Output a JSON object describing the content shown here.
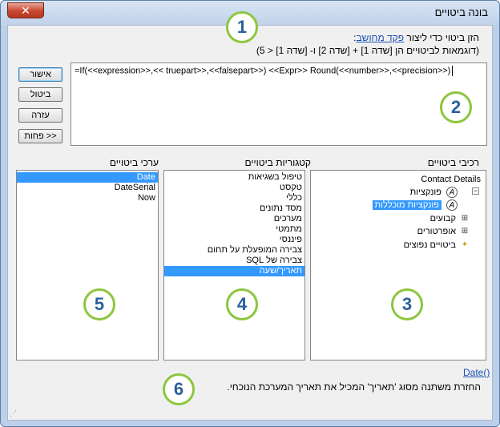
{
  "window": {
    "title": "בונה ביטויים",
    "close_label": "✕"
  },
  "intro": {
    "line1_prefix": "הזן ביטוי כדי ליצור",
    "line1_link": "פקד מחושב",
    "line1_suffix": ":",
    "line2": "(דוגמאות לביטויים הן [שדה 1] + [שדה 2] ו- [שדה 1] < 5)"
  },
  "expression": "=If(<<expression>>,<< truepart>>,<<falsepart>>) <<Expr>> Round(<<number>>,<<precision>>)",
  "buttons": {
    "ok": "אישור",
    "cancel": "ביטול",
    "help": "עזרה",
    "less": "<< פחות"
  },
  "headers": {
    "elements": "רכיבי ביטויים",
    "categories": "קטגוריות ביטויים",
    "values": "ערכי ביטויים"
  },
  "elements_tree": [
    {
      "label": "Contact Details",
      "icon": "form-icon"
    },
    {
      "label": "פונקציות",
      "icon": "function-icon"
    },
    {
      "label": "פונקציות מוכללות",
      "icon": "function-icon",
      "selected": true
    },
    {
      "label": "קבועים",
      "icon": "folder-icon"
    },
    {
      "label": "אופרטורים",
      "icon": "folder-icon"
    },
    {
      "label": "ביטויים נפוצים",
      "icon": "common-expr-icon"
    }
  ],
  "categories": [
    "טיפול בשגיאות",
    "טקסט",
    "כללי",
    "מסד נתונים",
    "מערכים",
    "מתמטי",
    "פיננסי",
    "צבירה המופעלת על תחום",
    "צבירה של SQL",
    "תאריך/שעה"
  ],
  "categories_selected": "תאריך/שעה",
  "values": [
    "Date",
    "DateSerial",
    "Now"
  ],
  "values_selected": "Date",
  "callouts": [
    "1",
    "2",
    "3",
    "4",
    "5",
    "6"
  ],
  "bottom": {
    "function_link": "Date()",
    "description": "החזרת משתנה מסוג 'תאריך' המכיל את תאריך המערכת הנוכחי."
  }
}
